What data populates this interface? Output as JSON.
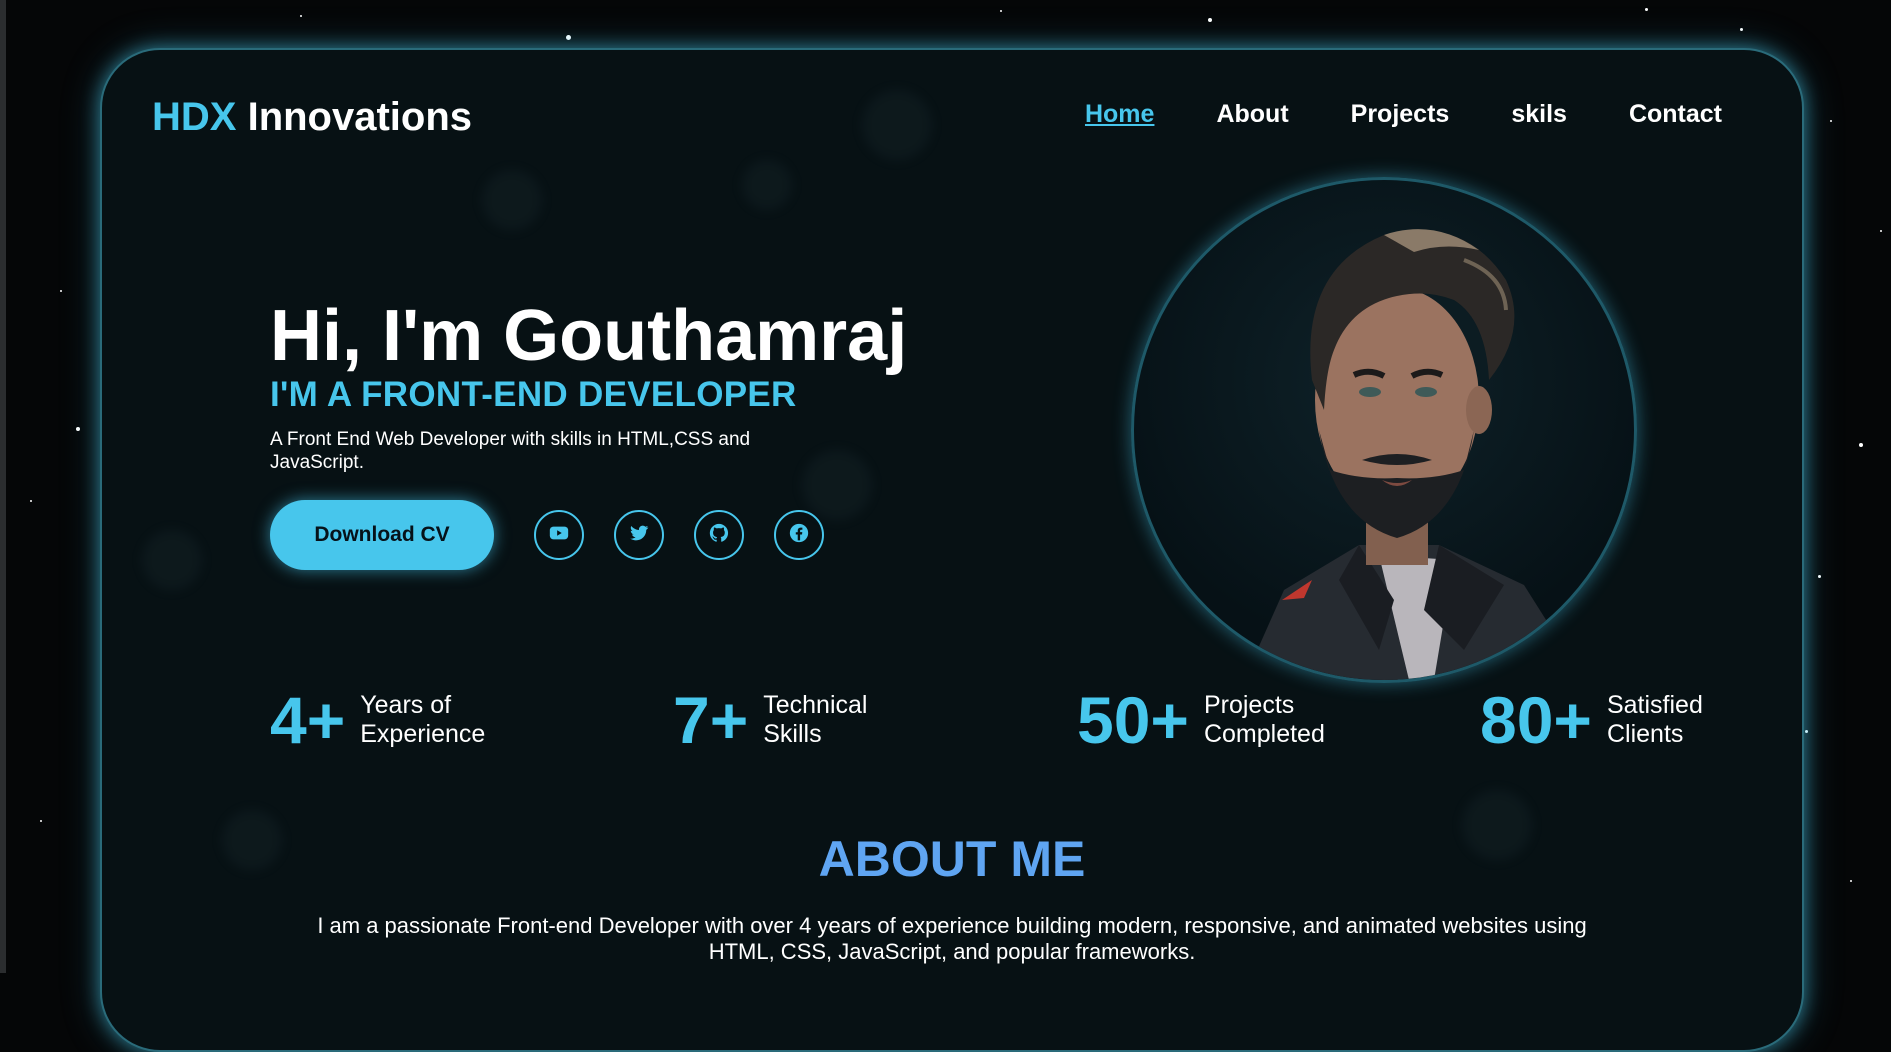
{
  "brand": {
    "part1": "HDX",
    "part2": "Innovations"
  },
  "nav": [
    {
      "label": "Home"
    },
    {
      "label": "About"
    },
    {
      "label": "Projects"
    },
    {
      "label": "skils"
    },
    {
      "label": "Contact"
    }
  ],
  "hero": {
    "title": "Hi, I'm Gouthamraj",
    "subtitle": "I'M A FRONT-END DEVELOPER",
    "description": "A Front End Web Developer with skills in HTML,CSS and JavaScript.",
    "cta_label": "Download CV",
    "socials": [
      {
        "icon": "youtube-icon"
      },
      {
        "icon": "twitter-icon"
      },
      {
        "icon": "github-icon"
      },
      {
        "icon": "facebook-icon"
      }
    ]
  },
  "stats": [
    {
      "value": "4+",
      "label": "Years of Experience"
    },
    {
      "value": "7+",
      "label": "Technical Skills"
    },
    {
      "value": "50+",
      "label": "Projects Completed"
    },
    {
      "value": "80+",
      "label": "Satisfied Clients"
    }
  ],
  "about": {
    "title": "ABOUT ME",
    "text": "I am a passionate Front-end Developer with over 4 years of experience building modern, responsive, and animated websites using HTML, CSS, JavaScript, and popular frameworks."
  },
  "colors": {
    "accent": "#47c6ec",
    "about_title": "#5fa5f2",
    "background": "#071114"
  }
}
